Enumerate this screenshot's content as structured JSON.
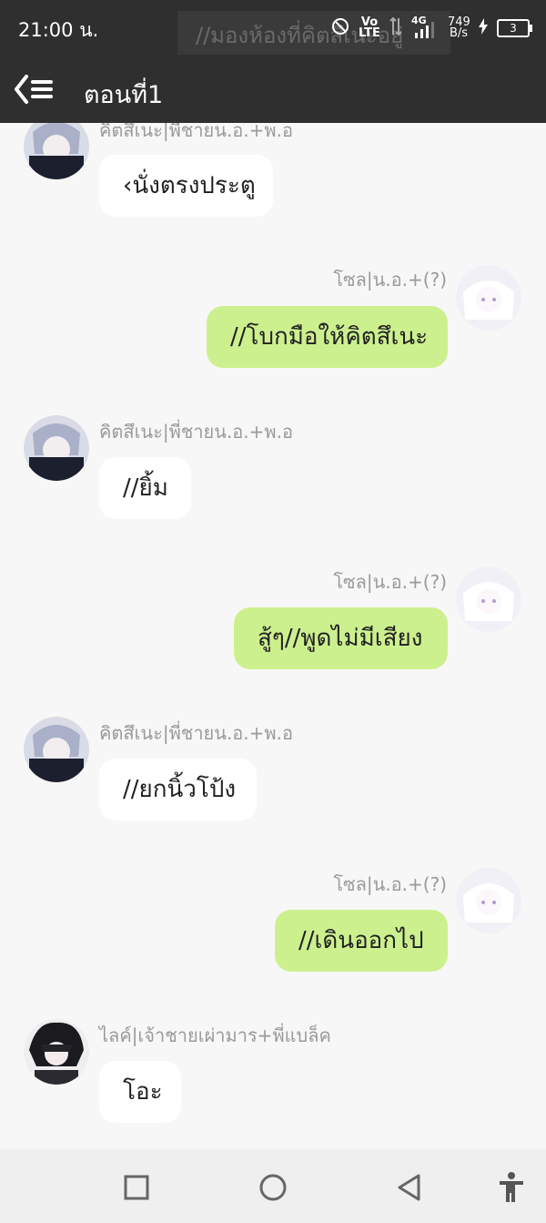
{
  "status": {
    "time": "21:00 น.",
    "volte": "Vo LTE",
    "network": "4G",
    "speed_value": "749",
    "speed_unit": "B/s",
    "battery": "3",
    "ghost_text": "//มองห้องที่คิตสึเนะอยู่"
  },
  "header": {
    "title": "ตอนที่1"
  },
  "messages": [
    {
      "side": "left",
      "avatar": "kitsune-avatar-icon",
      "name": "คิตสึเนะ|พี่ชายน.อ.+พ.อ",
      "text": "‹นั่งตรงประตู"
    },
    {
      "side": "right",
      "avatar": "sol-avatar-icon",
      "name": "โซล|น.อ.+(?)",
      "text": "//โบกมือให้คิตสึเนะ"
    },
    {
      "side": "left",
      "avatar": "kitsune-avatar-icon",
      "name": "คิตสึเนะ|พี่ชายน.อ.+พ.อ",
      "text": "//ยิ้ม"
    },
    {
      "side": "right",
      "avatar": "sol-avatar-icon",
      "name": "โซล|น.อ.+(?)",
      "text": "สู้ๆ//พูดไม่มีเสียง"
    },
    {
      "side": "left",
      "avatar": "kitsune-avatar-icon",
      "name": "คิตสึเนะ|พี่ชายน.อ.+พ.อ",
      "text": "//ยกนิ้วโป้ง"
    },
    {
      "side": "right",
      "avatar": "sol-avatar-icon",
      "name": "โซล|น.อ.+(?)",
      "text": "//เดินออกไป"
    },
    {
      "side": "left",
      "avatar": "like-avatar-icon",
      "name": "ไลค์|เจ้าชายเผ่ามาร+พี่แบล็ค",
      "text": "โอะ"
    }
  ],
  "colors": {
    "header_bg": "#2f2f2f",
    "chat_bg": "#f7f7f7",
    "left_bubble": "#ffffff",
    "right_bubble": "#cdf08f",
    "name_text": "#9a9a9a"
  }
}
